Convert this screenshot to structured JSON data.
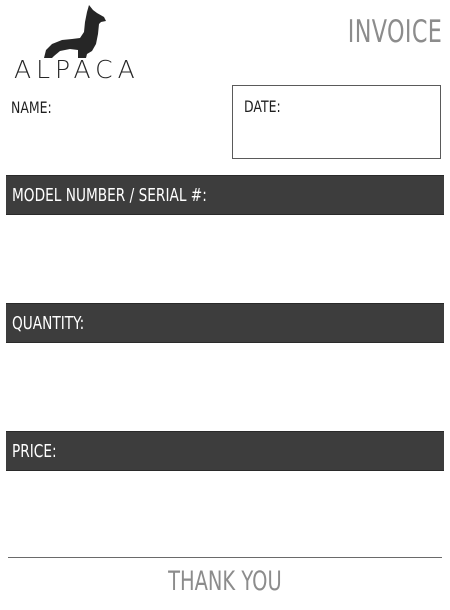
{
  "brand": {
    "logo_text": "ALPACA",
    "logo_icon": "alpaca-icon",
    "logo_color": "#262626"
  },
  "header": {
    "title": "INVOICE",
    "title_color": "#8c8c8c"
  },
  "fields": {
    "name_label": "NAME:",
    "date_label": "DATE:"
  },
  "sections": [
    {
      "label": "MODEL NUMBER / SERIAL #:"
    },
    {
      "label": "QUANTITY:"
    },
    {
      "label": "PRICE:"
    }
  ],
  "section_bar_color": "#3d3d3d",
  "footer": {
    "text": "THANK YOU",
    "text_color": "#8c8c8c"
  }
}
